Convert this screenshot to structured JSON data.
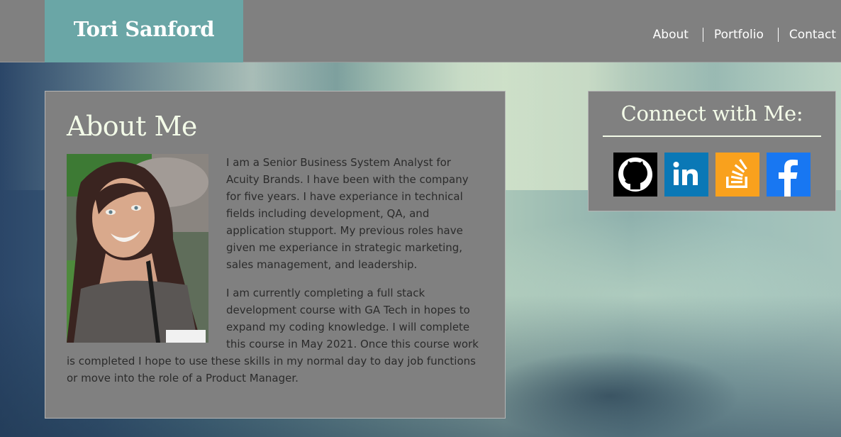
{
  "header": {
    "brand": "Tori Sanford",
    "nav": [
      {
        "label": "About"
      },
      {
        "label": "Portfolio"
      },
      {
        "label": "Contact"
      }
    ]
  },
  "about": {
    "title": "About Me",
    "paragraphs": [
      "I am a Senior Business System Analyst for Acuity Brands. I have been with the company for five years. I have experiance in technical fields including development, QA, and application stupport. My previous roles have given me experiance in strategic marketing, sales management, and leadership.",
      "I am currently completing a full stack development course with GA Tech in hopes to expand my coding knowledge. I will complete this course in May 2021. Once this course work is completed I hope to use these skills in my normal day to day job functions or move into the role of a Product Manager."
    ]
  },
  "connect": {
    "title": "Connect with Me:",
    "links": [
      {
        "icon": "github-icon",
        "color": "#000000"
      },
      {
        "icon": "linkedin-icon",
        "color": "#0a78b6"
      },
      {
        "icon": "stackoverflow-icon",
        "color": "#f9a11d"
      },
      {
        "icon": "facebook-icon",
        "color": "#1877f2"
      }
    ]
  },
  "colors": {
    "header_bg": "#808080",
    "brand_bg": "#6aa6a6",
    "card_bg": "#808080",
    "heading_text": "#f3fbe8"
  }
}
